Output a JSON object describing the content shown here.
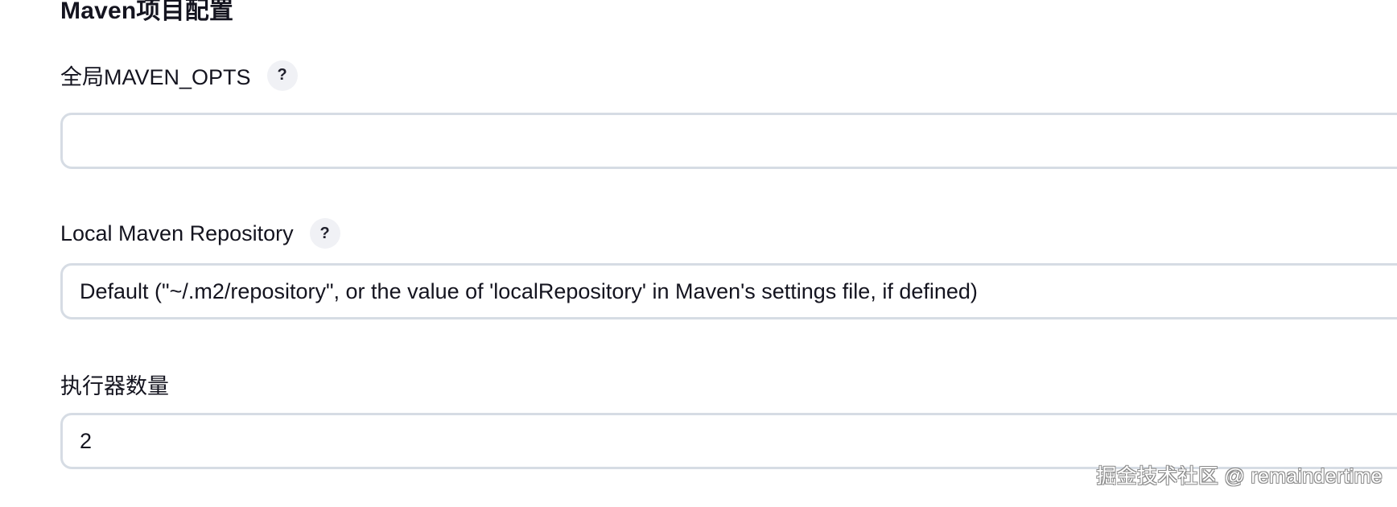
{
  "section": {
    "title": "Maven项目配置"
  },
  "fields": {
    "maven_opts": {
      "label": "全局MAVEN_OPTS",
      "help": "?",
      "value": ""
    },
    "local_repo": {
      "label": "Local Maven Repository",
      "help": "?",
      "selected": "Default (\"~/.m2/repository\", or the value of 'localRepository' in Maven's settings file, if defined)"
    },
    "executors": {
      "label": "执行器数量",
      "value": "2"
    }
  },
  "watermark": "掘金技术社区 @ remaindertime"
}
